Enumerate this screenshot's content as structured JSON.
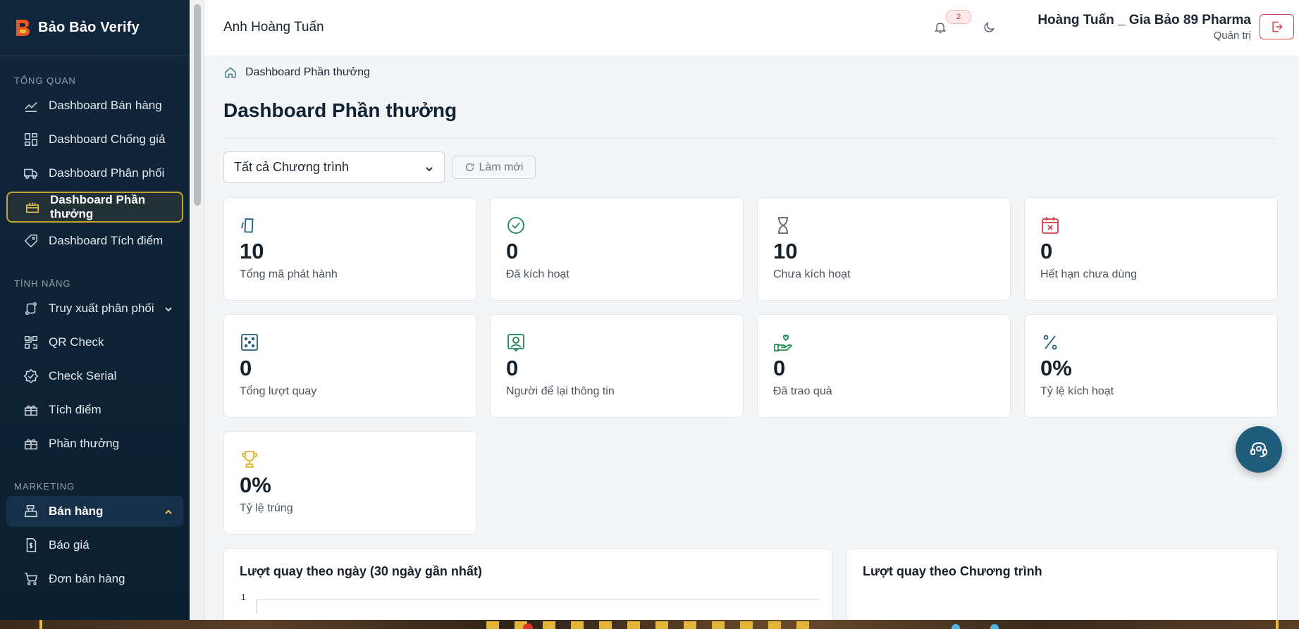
{
  "brand": {
    "name": "Bảo Bảo Verify"
  },
  "sidebar": {
    "sections": [
      {
        "title": "TỔNG QUAN"
      },
      {
        "title": "TÍNH NĂNG"
      },
      {
        "title": "MARKETING"
      }
    ],
    "items": [
      {
        "label": "Dashboard Bán hàng",
        "icon": "line-chart-icon"
      },
      {
        "label": "Dashboard Chống giả",
        "icon": "dashboard-grid-icon"
      },
      {
        "label": "Dashboard Phân phối",
        "icon": "truck-icon"
      },
      {
        "label": "Dashboard Phần thưởng",
        "icon": "gift-icon",
        "active": true
      },
      {
        "label": "Dashboard Tích điểm",
        "icon": "tag-icon"
      },
      {
        "label": "Truy xuất phân phối",
        "icon": "route-icon"
      },
      {
        "label": "QR Check",
        "icon": "qr-code-icon"
      },
      {
        "label": "Check Serial",
        "icon": "badge-check-icon"
      },
      {
        "label": "Tích điểm",
        "icon": "gift-box-icon"
      },
      {
        "label": "Phần thưởng",
        "icon": "gift-box-icon"
      },
      {
        "label": "Bán hàng",
        "icon": "cash-register-icon"
      },
      {
        "label": "Báo giá",
        "icon": "quote-document-icon"
      },
      {
        "label": "Đơn bán hàng",
        "icon": "cart-icon"
      }
    ]
  },
  "header": {
    "greeting": "Anh Hoàng Tuấn",
    "notification_count": "2",
    "user_name": "Hoàng Tuấn _ Gia Bảo 89 Pharma",
    "user_role": "Quản trị"
  },
  "breadcrumb": {
    "label": "Dashboard Phần thưởng"
  },
  "page": {
    "title": "Dashboard Phần thưởng",
    "program_select": "Tất cả Chương trình",
    "refresh_label": "Làm mới"
  },
  "stats": [
    {
      "value": "10",
      "label": "Tổng mã phát hành",
      "icon": "ticket-icon",
      "color": "#1f5d7a"
    },
    {
      "value": "0",
      "label": "Đã kích hoạt",
      "icon": "check-circle-icon",
      "color": "#1e8a52"
    },
    {
      "value": "10",
      "label": "Chưa kích hoạt",
      "icon": "hourglass-icon",
      "color": "#5b6673"
    },
    {
      "value": "0",
      "label": "Hết hạn chưa dùng",
      "icon": "calendar-x-icon",
      "color": "#d23a45"
    },
    {
      "value": "0",
      "label": "Tổng lượt quay",
      "icon": "dice-icon",
      "color": "#1f5d7a"
    },
    {
      "value": "0",
      "label": "Người để lại thông tin",
      "icon": "user-square-icon",
      "color": "#1e8a52"
    },
    {
      "value": "0",
      "label": "Đã trao quà",
      "icon": "hand-heart-icon",
      "color": "#1e8a52"
    },
    {
      "value": "0%",
      "label": "Tỷ lệ kích hoạt",
      "icon": "percent-icon",
      "color": "#1f5d7a"
    },
    {
      "value": "0%",
      "label": "Tỷ lệ trúng",
      "icon": "trophy-icon",
      "color": "#e3b12a"
    }
  ],
  "panels": {
    "daily_title": "Lượt quay theo ngày (30 ngày gần nhất)",
    "daily_ytick": "1",
    "program_title": "Lượt quay theo Chương trình"
  }
}
